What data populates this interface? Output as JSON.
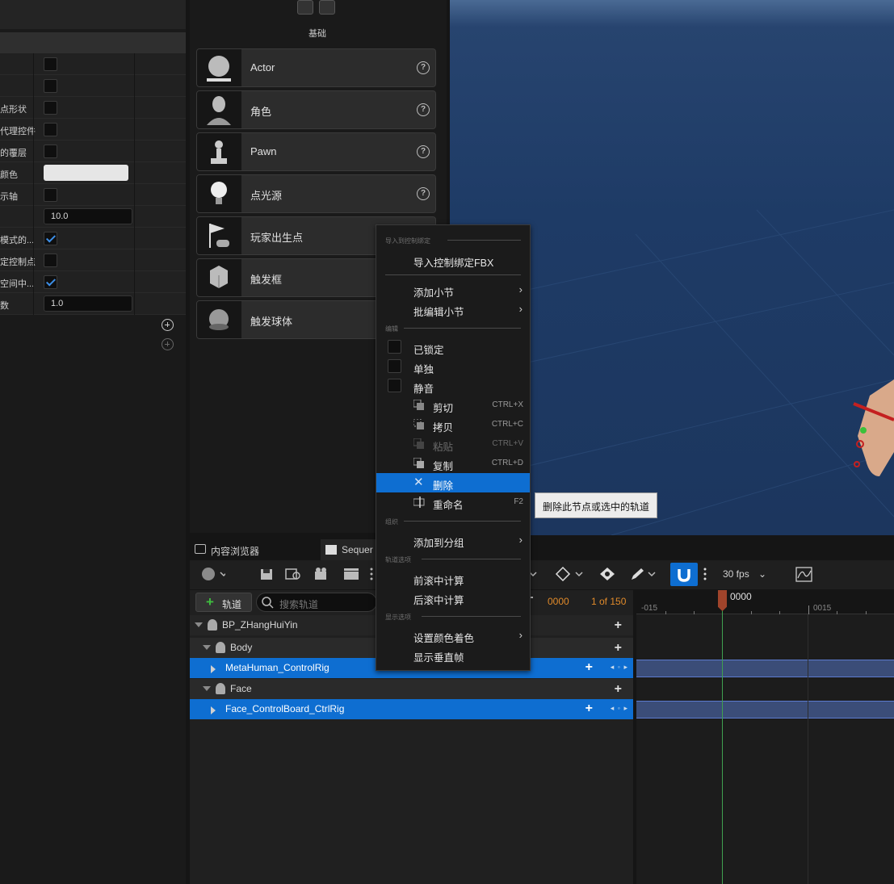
{
  "details": {
    "rows": [
      {
        "label": "",
        "type": "checkbox",
        "checked": false
      },
      {
        "label": "",
        "type": "checkbox",
        "checked": false
      },
      {
        "label": "点形状",
        "type": "checkbox",
        "checked": false
      },
      {
        "label": "代理控件",
        "type": "checkbox",
        "checked": false
      },
      {
        "label": "的覆层",
        "type": "checkbox",
        "checked": false
      },
      {
        "label": "颜色",
        "type": "color",
        "value": "#e6e6e6"
      },
      {
        "label": "示轴",
        "type": "checkbox",
        "checked": false
      },
      {
        "label": "",
        "type": "number",
        "value": "10.0"
      },
      {
        "label": "模式的...",
        "type": "checkbox",
        "checked": true
      },
      {
        "label": "定控制点",
        "type": "checkbox",
        "checked": false
      },
      {
        "label": "空间中...",
        "type": "checkbox",
        "checked": true
      },
      {
        "label": "数",
        "type": "number",
        "value": "1.0"
      }
    ]
  },
  "place_actors": {
    "category": "基础",
    "items": [
      {
        "label": "Actor",
        "icon": "sphere-icon",
        "help": "?"
      },
      {
        "label": "角色",
        "icon": "character-icon",
        "help": "?"
      },
      {
        "label": "Pawn",
        "icon": "pawn-icon",
        "help": "?"
      },
      {
        "label": "点光源",
        "icon": "light-bulb-icon",
        "help": "?"
      },
      {
        "label": "玩家出生点",
        "icon": "player-start-icon"
      },
      {
        "label": "触发框",
        "icon": "trigger-box-icon"
      },
      {
        "label": "触发球体",
        "icon": "trigger-sphere-icon"
      }
    ]
  },
  "tabs": {
    "content_browser": "内容浏览器",
    "sequencer": "Sequer"
  },
  "sequencer": {
    "add_track": "轨道",
    "search_placeholder": "搜索轨道",
    "frame": "0000",
    "frame_count": "1 of 150",
    "fps": "30 fps",
    "playhead_label": "0000",
    "ruler": [
      "-015",
      "0015"
    ],
    "tree": [
      {
        "label": "BP_ZHangHuiYin",
        "level": 0,
        "selected": false
      },
      {
        "label": "Body",
        "level": 1,
        "selected": false
      },
      {
        "label": "MetaHuman_ControlRig",
        "level": 2,
        "selected": true
      },
      {
        "label": "Face",
        "level": 1,
        "selected": false
      },
      {
        "label": "Face_ControlBoard_CtrlRig",
        "level": 2,
        "selected": true
      }
    ]
  },
  "context_menu": {
    "sections": {
      "import": "导入到控制绑定",
      "edit": "编辑",
      "group": "组织",
      "track_options": "轨道选项",
      "display_options": "显示选项"
    },
    "import_fbx": "导入控制绑定FBX",
    "add_section": "添加小节",
    "batch_edit": "批编辑小节",
    "locked": "已锁定",
    "solo": "单独",
    "mute": "静音",
    "cut": "剪切",
    "cut_sc": "CTRL+X",
    "copy": "拷贝",
    "copy_sc": "CTRL+C",
    "paste": "粘贴",
    "paste_sc": "CTRL+V",
    "duplicate": "复制",
    "duplicate_sc": "CTRL+D",
    "delete": "删除",
    "rename": "重命名",
    "rename_sc": "F2",
    "add_to_group": "添加到分组",
    "pre_roll": "前滚中计算",
    "post_roll": "后滚中计算",
    "set_color": "设置颜色着色",
    "show_vertical_frames": "显示垂直帧"
  },
  "tooltip": "删除此节点或选中的轨道",
  "colors": {
    "accent": "#0e6ed1",
    "playhead": "#a0442b",
    "frame_orange": "#e08a2a",
    "viewport_blue": "#1e3b66"
  }
}
